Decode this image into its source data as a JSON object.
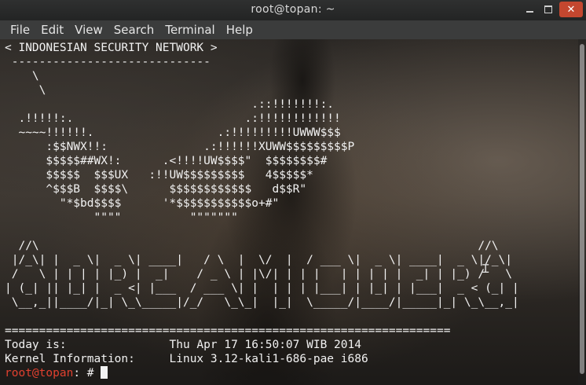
{
  "window": {
    "title": "root@topan: ~",
    "close_glyph": "✕"
  },
  "menu": [
    "File",
    "Edit",
    "View",
    "Search",
    "Terminal",
    "Help"
  ],
  "terminal": {
    "output": "< INDONESIAN SECURITY NETWORK >\n -----------------------------\n    \\\n     \\\n                                    .::!!!!!!!:.\n  .!!!!!:.                         .:!!!!!!!!!!!!\n  ~~~~!!!!!!.                  .:!!!!!!!!!UWWW$$$\n      :$$NWX!!:              .:!!!!!!XUWW$$$$$$$$$P\n      $$$$$##WX!:      .<!!!!UW$$$$\"  $$$$$$$$#\n      $$$$$  $$$UX   :!!UW$$$$$$$$$   4$$$$$*\n      ^$$$B  $$$$\\      $$$$$$$$$$$$   d$$R\"\n        \"*$bd$$$$      '*$$$$$$$$$$$o+#\"\n             \"\"\"\"          \"\"\"\"\"\"\"\n\n  //\\                                                                //\\\n |/_\\| |  _ \\|  _ \\| ____|   / \\  |  \\/  |  / ___ \\|  _ \\| ____|  _ \\|/_\\|\n /   \\ | | | | |_) |  _|    / _ \\ | |\\/| | | |   | | | | |  _| | |_) /   \\\n| (_| || |_| |  _ <| |___  / ___ \\| |  | | | |___| | |_| | |___|  _ < (_| |\n \\__,_||____/|_| \\_\\_____|/_/   \\_\\_|  |_|  \\_____/|____/|_____|_| \\_\\__,_|\n\n=================================================================\nToday is:               Thu Apr 17 16:50:07 WIB 2014\nKernel Information:     Linux 3.12-kali1-686-pae i686",
    "prompt_user": "root@topan",
    "prompt_suffix": ": # "
  },
  "colors": {
    "prompt_user": "#e0402f",
    "close_button": "#c4472f",
    "text": "#f2f2f2"
  }
}
